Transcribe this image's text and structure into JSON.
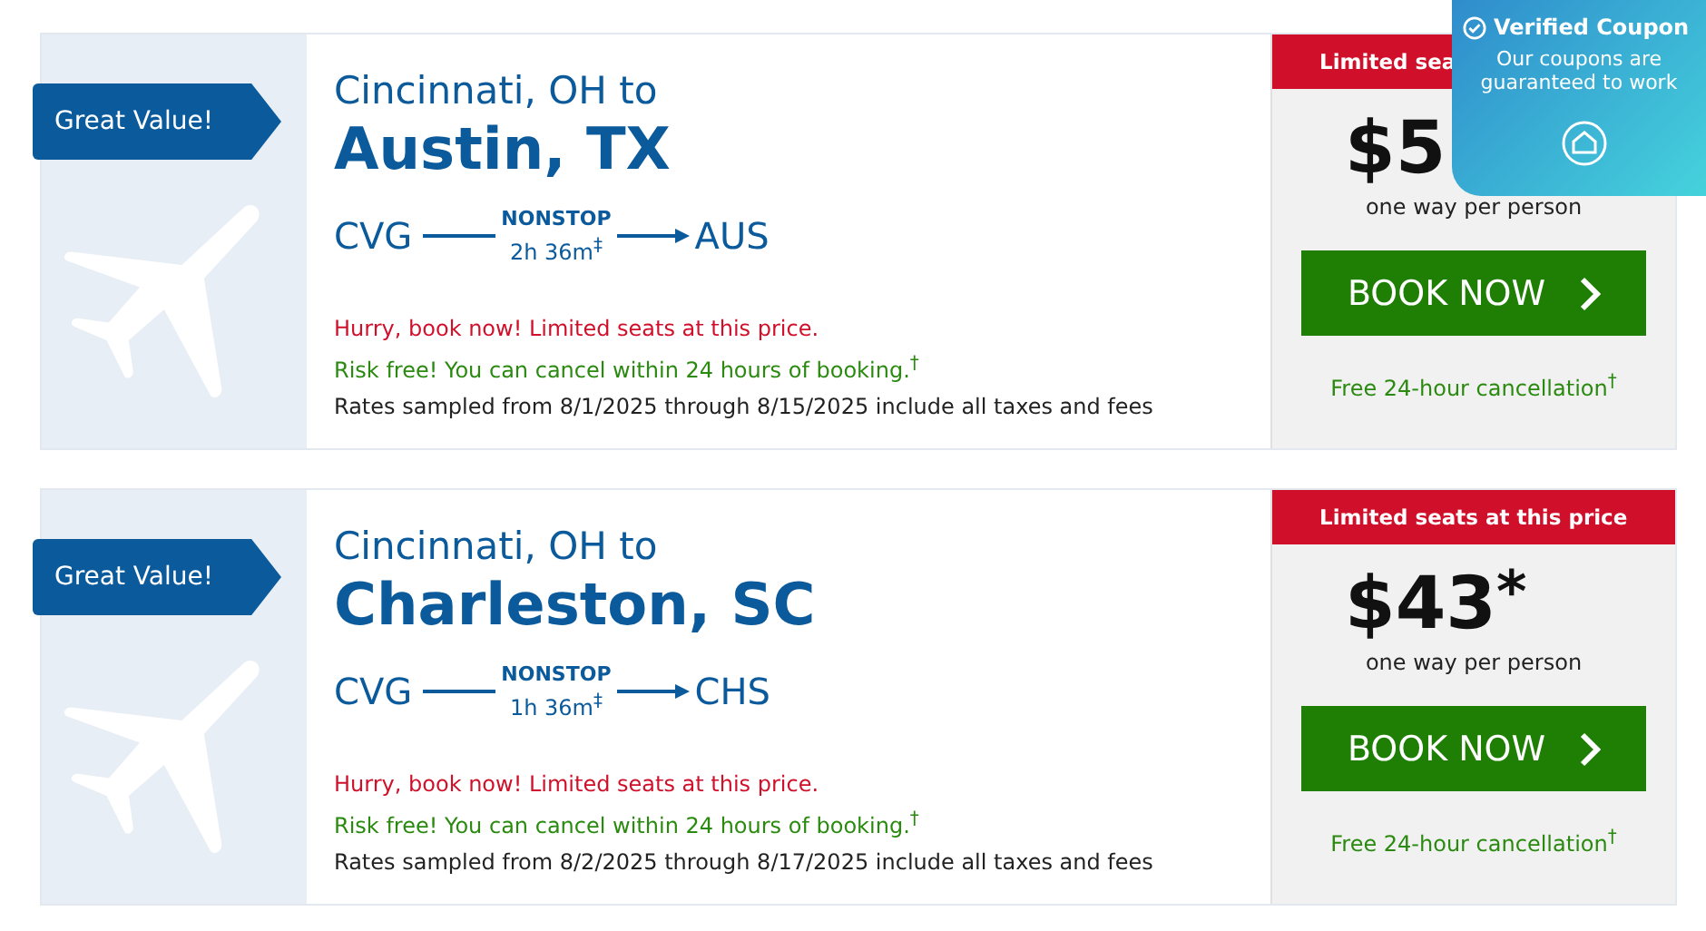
{
  "cards": [
    {
      "badge": "Great Value!",
      "origin_line": "Cincinnati, OH to",
      "destination": "Austin, TX",
      "from": "CVG",
      "to": "AUS",
      "stop_label": "NONSTOP",
      "duration": "2h 36m$^{‡}$",
      "notes": [
        {
          "kind": "urgent",
          "text": "Hurry, book now! Limited seats at this price."
        },
        {
          "kind": "risk",
          "text": "Risk free! You can cancel within 24 hours of booking.$^{†}$"
        },
        {
          "kind": "info",
          "text": "Rates sampled from 8/1/2025 through 8/15/2025 include all taxes and fees"
        }
      ],
      "banner": "Limited sea",
      "price": "$5",
      "price_note": "one way per person",
      "button": "BOOK NOW",
      "cancellation": "Free 24-hour cancellation$^{†}$"
    },
    {
      "badge": "Great Value!",
      "origin_line": "Cincinnati, OH to",
      "destination": "Charleston, SC",
      "from": "CVG",
      "to": "CHS",
      "stop_label": "NONSTOP",
      "duration": "1h 36m$^{‡}$",
      "notes": [
        {
          "kind": "urgent",
          "text": "Hurry, book now! Limited seats at this price."
        },
        {
          "kind": "risk",
          "text": "Risk free! You can cancel within 24 hours of booking.$^{†}$"
        },
        {
          "kind": "info",
          "text": "Rates sampled from 8/2/2025 through 8/17/2025 include all taxes and fees"
        }
      ],
      "banner": "Limited seats at this price",
      "price": "$43",
      "price_mark": "*",
      "price_note": "one way per person",
      "button": "BOOK NOW",
      "cancellation": "Free 24-hour cancellation$^{†}$"
    }
  ],
  "coupon": {
    "title": "Verified Coupon",
    "text": "Our coupons are guaranteed to work"
  }
}
